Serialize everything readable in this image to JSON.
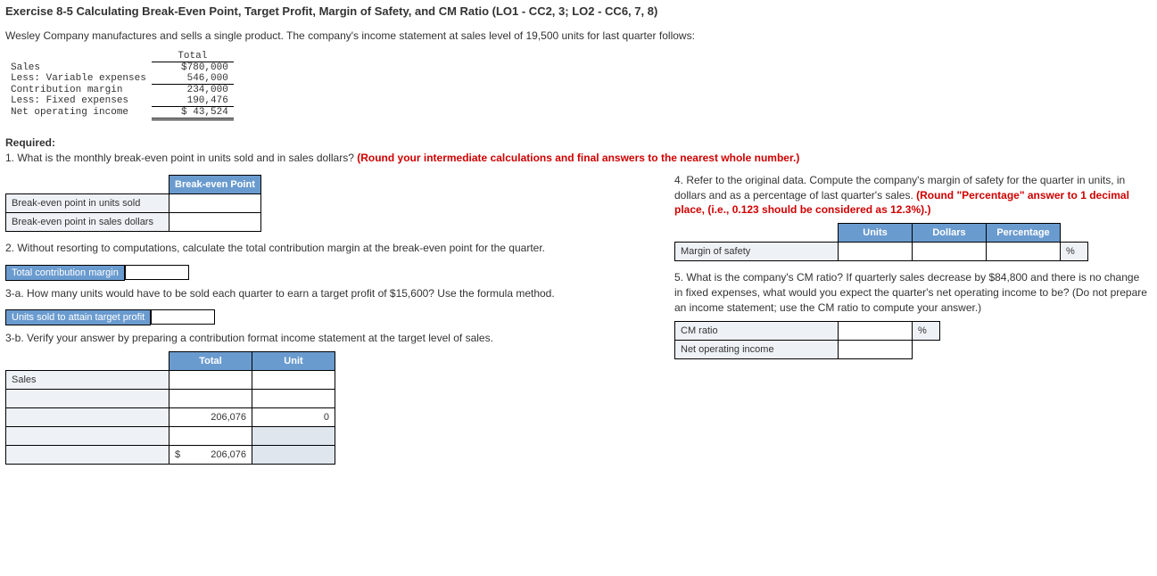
{
  "title": "Exercise 8-5 Calculating Break-Even Point, Target Profit, Margin of Safety, and CM Ratio (LO1 - CC2, 3; LO2 - CC6, 7, 8)",
  "intro": "Wesley Company manufactures and sells a single product. The company's income statement at sales level of 19,500 units for last quarter follows:",
  "income": {
    "header": "Total",
    "rows": [
      {
        "label": "Sales",
        "value": "$780,000"
      },
      {
        "label": "Less: Variable expenses",
        "value": "546,000",
        "ul": true
      },
      {
        "label": "Contribution margin",
        "value": "234,000"
      },
      {
        "label": "Less: Fixed expenses",
        "value": "190,476",
        "ul": true
      },
      {
        "label": "Net operating income",
        "value": "$ 43,524",
        "dbl": true
      }
    ]
  },
  "required_label": "Required:",
  "q1": {
    "text": "1. What is the monthly break-even point in units sold and in sales dollars? ",
    "red": "(Round your intermediate calculations and final answers to the nearest whole number.)",
    "header": "Break-even Point",
    "row1": "Break-even point in units sold",
    "row2": "Break-even point in sales dollars"
  },
  "q2": {
    "text": "2. Without resorting to computations, calculate the total contribution margin at the break-even point for the quarter.",
    "label": "Total contribution margin"
  },
  "q3a": {
    "text": "3-a. How many units would have to be sold each quarter to earn a target profit of $15,600? Use the formula method.",
    "label": "Units sold to attain target profit"
  },
  "q3b": {
    "text": "3-b. Verify your answer by preparing a contribution format income statement at the target level of sales.",
    "h_total": "Total",
    "h_unit": "Unit",
    "sales": "Sales",
    "v1": "206,076",
    "v2": "0",
    "v3": "$",
    "v4": "206,076"
  },
  "q4": {
    "text": "4. Refer to the original data. Compute the company's margin of safety for the quarter in units, in dollars and as a percentage of last quarter's sales. ",
    "red": "(Round \"Percentage\" answer to 1 decimal place, (i.e., 0.123 should be considered as 12.3%).)",
    "h_units": "Units",
    "h_dollars": "Dollars",
    "h_pct": "Percentage",
    "row": "Margin of safety",
    "pct_unit": "%"
  },
  "q5": {
    "text": "5. What is the company's CM ratio? If quarterly sales decrease by $84,800 and there is no change in fixed expenses, what would you expect the quarter's net operating income to be? (Do not prepare an income statement; use the CM ratio to compute your answer.)",
    "row1": "CM ratio",
    "row2": "Net operating income",
    "pct_unit": "%"
  }
}
